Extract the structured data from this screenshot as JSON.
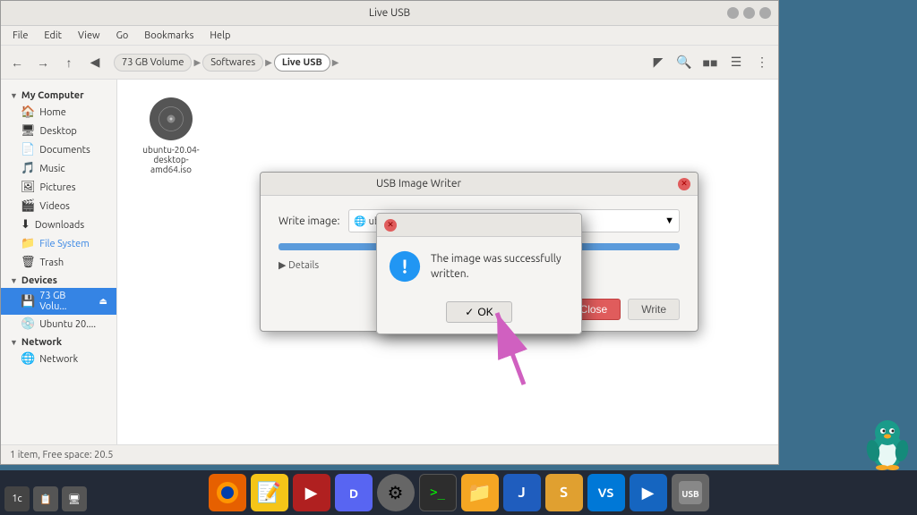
{
  "window": {
    "title": "Live USB",
    "menu": {
      "items": [
        "File",
        "Edit",
        "View",
        "Go",
        "Bookmarks",
        "Help"
      ]
    },
    "breadcrumb": {
      "items": [
        "73 GB Volume",
        "Softwares",
        "Live USB"
      ],
      "active": "Live USB"
    }
  },
  "sidebar": {
    "my_computer": {
      "title": "My Computer",
      "items": [
        {
          "label": "Home",
          "icon": "🏠"
        },
        {
          "label": "Desktop",
          "icon": "🖥"
        },
        {
          "label": "Documents",
          "icon": "📄"
        },
        {
          "label": "Music",
          "icon": "🎵"
        },
        {
          "label": "Pictures",
          "icon": "🖼"
        },
        {
          "label": "Videos",
          "icon": "🎬"
        },
        {
          "label": "Downloads",
          "icon": "⬇"
        },
        {
          "label": "File System",
          "icon": "📁"
        },
        {
          "label": "Trash",
          "icon": "🗑"
        }
      ]
    },
    "devices": {
      "title": "Devices",
      "items": [
        {
          "label": "73 GB Volu...",
          "icon": "💾",
          "eject": true
        },
        {
          "label": "Ubuntu 20....",
          "icon": "💿"
        }
      ]
    },
    "network": {
      "title": "Network",
      "items": [
        {
          "label": "Network",
          "icon": "🌐"
        }
      ]
    }
  },
  "file": {
    "name": "ubuntu-20.04-desktop-amd64.iso",
    "icon_color": "#444"
  },
  "status_bar": {
    "text": "1 item, Free space: 20.5"
  },
  "usb_dialog": {
    "title": "USB Image Writer",
    "write_image_label": "Write image:",
    "image_value": "ubuntu-4...",
    "details_label": "Details",
    "close_label": "Close",
    "write_label": "Write"
  },
  "success_dialog": {
    "message": "The image was successfully written.",
    "ok_label": "OK"
  },
  "taskbar": {
    "apps": [
      {
        "name": "firefox",
        "color": "#e66000",
        "label": "FF"
      },
      {
        "name": "notes",
        "color": "#f5c518",
        "label": "📝"
      },
      {
        "name": "media",
        "color": "#d04030",
        "label": "▶"
      },
      {
        "name": "discord",
        "color": "#5865f2",
        "label": "DC"
      },
      {
        "name": "settings",
        "color": "#888",
        "label": "⚙"
      },
      {
        "name": "terminal",
        "color": "#2d2d2d",
        "label": ">"
      },
      {
        "name": "files",
        "color": "#f5a623",
        "label": "📁"
      },
      {
        "name": "joplin",
        "color": "#1f5dbe",
        "label": "J"
      },
      {
        "name": "sublime",
        "color": "#e0a030",
        "label": "S"
      },
      {
        "name": "vscode",
        "color": "#0078d7",
        "label": "VS"
      },
      {
        "name": "media2",
        "color": "#1565c0",
        "label": "▶"
      },
      {
        "name": "usb",
        "color": "#777",
        "label": "USB"
      }
    ]
  }
}
